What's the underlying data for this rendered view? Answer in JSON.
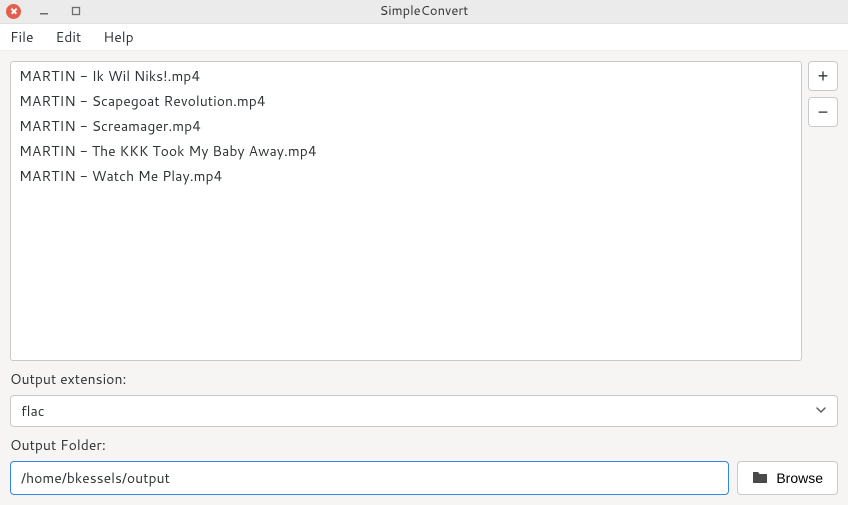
{
  "window": {
    "title": "SimpleConvert"
  },
  "menubar": {
    "file": "File",
    "edit": "Edit",
    "help": "Help"
  },
  "files": [
    "MARTIN - Ik Wil Niks!.mp4",
    "MARTIN - Scapegoat Revolution.mp4",
    "MARTIN - Screamager.mp4",
    "MARTIN - The KKK Took My Baby Away.mp4",
    "MARTIN - Watch Me Play.mp4"
  ],
  "labels": {
    "output_extension": "Output extension:",
    "output_folder": "Output Folder:",
    "browse": "Browse"
  },
  "output": {
    "extension_selected": "flac",
    "folder": "/home/bkessels/output"
  },
  "icons": {
    "add": "+",
    "remove": "−"
  }
}
